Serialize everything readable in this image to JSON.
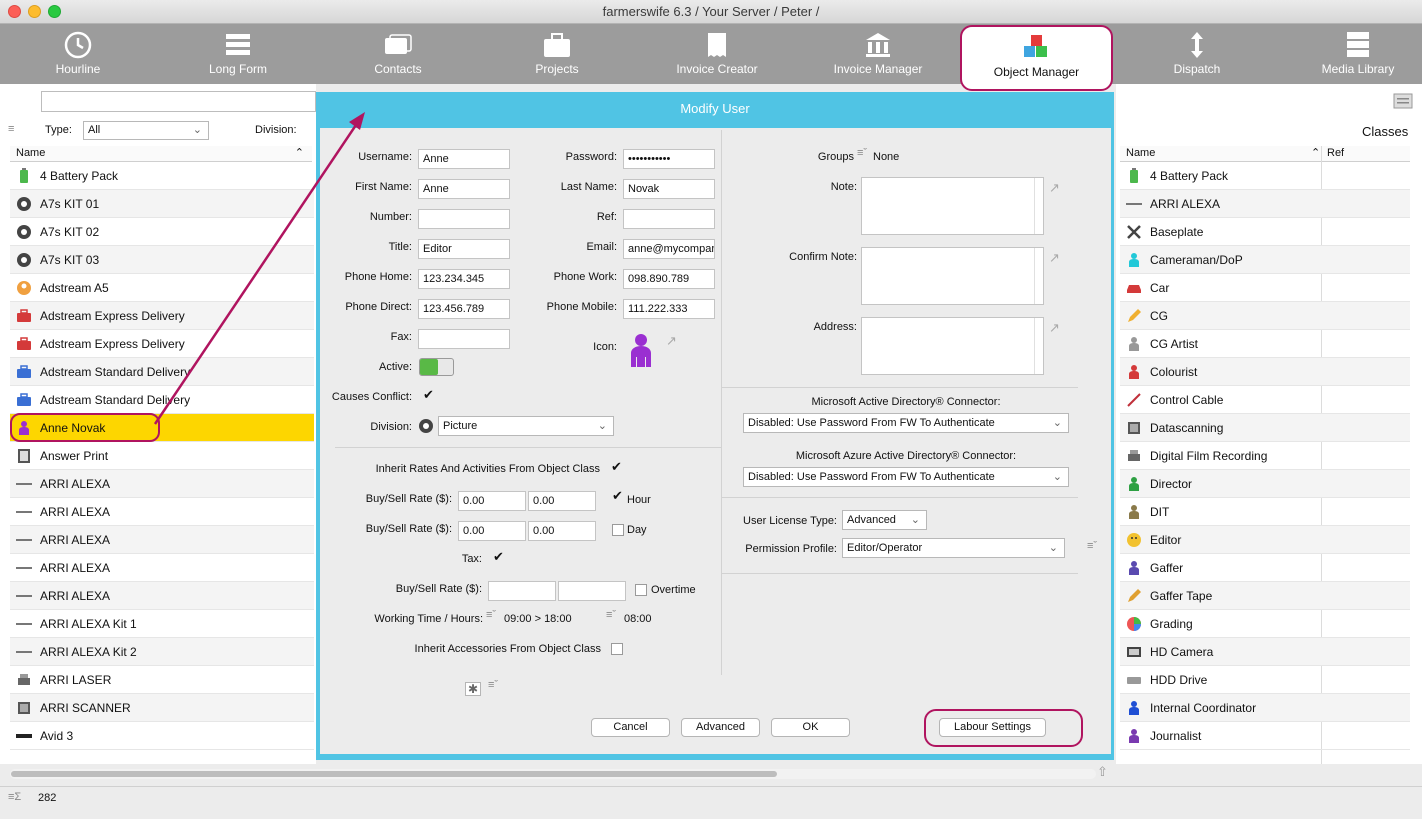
{
  "window": {
    "title": "farmerswife 6.3  / Your Server / Peter /"
  },
  "toolbar": {
    "items": [
      {
        "label": "Hourline",
        "icon": "clock-icon"
      },
      {
        "label": "Long Form",
        "icon": "longform-icon"
      },
      {
        "label": "Contacts",
        "icon": "contacts-icon"
      },
      {
        "label": "Projects",
        "icon": "briefcase-icon"
      },
      {
        "label": "Invoice Creator",
        "icon": "invoice-creator-icon"
      },
      {
        "label": "Invoice Manager",
        "icon": "bank-icon"
      },
      {
        "label": "Object Manager",
        "icon": "cubes-icon",
        "active": true
      },
      {
        "label": "Dispatch",
        "icon": "dispatch-icon"
      },
      {
        "label": "Media Library",
        "icon": "server-icon"
      }
    ]
  },
  "left_panel": {
    "type_label": "Type:",
    "type_value": "All",
    "division_label": "Division:",
    "column_name": "Name",
    "rows": [
      "4 Battery Pack",
      "A7s KIT 01",
      "A7s KIT 02",
      "A7s KIT 03",
      "Adstream A5",
      "Adstream Express Delivery",
      "Adstream Express Delivery",
      "Adstream Standard Delivery",
      "Adstream Standard Delivery",
      "Anne Novak",
      "Answer Print",
      "ARRI ALEXA",
      "ARRI ALEXA",
      "ARRI ALEXA",
      "ARRI ALEXA",
      "ARRI ALEXA",
      "ARRI ALEXA Kit 1",
      "ARRI ALEXA Kit 2",
      "ARRI LASER",
      "ARRI SCANNER",
      "Avid 3"
    ],
    "selected": "Anne Novak"
  },
  "right_panel": {
    "title": "Classes",
    "column_name": "Name",
    "column_ref": "Ref",
    "rows": [
      "4 Battery Pack",
      "ARRI ALEXA",
      "Baseplate",
      "Cameraman/DoP",
      "Car",
      "CG",
      "CG Artist",
      "Colourist",
      "Control Cable",
      "Datascanning",
      "Digital Film Recording",
      "Director",
      "DIT",
      "Editor",
      "Gaffer",
      "Gaffer Tape",
      "Grading",
      "HD Camera",
      "HDD Drive",
      "Internal Coordinator",
      "Journalist"
    ]
  },
  "dialog": {
    "title": "Modify User",
    "username_label": "Username:",
    "username": "Anne",
    "password_label": "Password:",
    "password": "•••••••••••",
    "firstname_label": "First Name:",
    "firstname": "Anne",
    "lastname_label": "Last Name:",
    "lastname": "Novak",
    "number_label": "Number:",
    "number": "",
    "ref_label": "Ref:",
    "ref": "",
    "title_label": "Title:",
    "title_value": "Editor",
    "email_label": "Email:",
    "email": "anne@mycompar",
    "phone_home_label": "Phone Home:",
    "phone_home": "123.234.345",
    "phone_work_label": "Phone Work:",
    "phone_work": "098.890.789",
    "phone_direct_label": "Phone Direct:",
    "phone_direct": "123.456.789",
    "phone_mobile_label": "Phone Mobile:",
    "phone_mobile": "111.222.333",
    "fax_label": "Fax:",
    "fax": "",
    "icon_label": "Icon:",
    "active_label": "Active:",
    "causes_conflict_label": "Causes Conflict:",
    "division_label": "Division:",
    "division_value": "Picture",
    "inherit_rates_label": "Inherit Rates And Activities From Object Class",
    "buysell_label": "Buy/Sell Rate ($):",
    "rate_hour_buy": "0.00",
    "rate_hour_sell": "0.00",
    "hour_label": "Hour",
    "rate_day_buy": "0.00",
    "rate_day_sell": "0.00",
    "day_label": "Day",
    "tax_label": "Tax:",
    "overtime_label": "Overtime",
    "working_time_label": "Working Time / Hours:",
    "working_time": "09:00 > 18:00",
    "working_hours": "08:00",
    "inherit_accessories_label": "Inherit Accessories From Object Class",
    "groups_label": "Groups",
    "groups_value": "None",
    "note_label": "Note:",
    "confirm_note_label": "Confirm Note:",
    "address_label": "Address:",
    "ad_label": "Microsoft Active Directory® Connector:",
    "ad_value": "Disabled: Use Password From FW To Authenticate",
    "azure_label": "Microsoft Azure Active Directory® Connector:",
    "azure_value": "Disabled: Use Password From FW To Authenticate",
    "license_label": "User License Type:",
    "license_value": "Advanced",
    "permission_label": "Permission Profile:",
    "permission_value": "Editor/Operator",
    "cancel_label": "Cancel",
    "advanced_label": "Advanced",
    "ok_label": "OK",
    "labour_label": "Labour Settings"
  },
  "status": {
    "count": "282"
  },
  "colors": {
    "accent": "#50c4e4",
    "highlight": "#fdd600",
    "annotation": "#b0145f"
  }
}
